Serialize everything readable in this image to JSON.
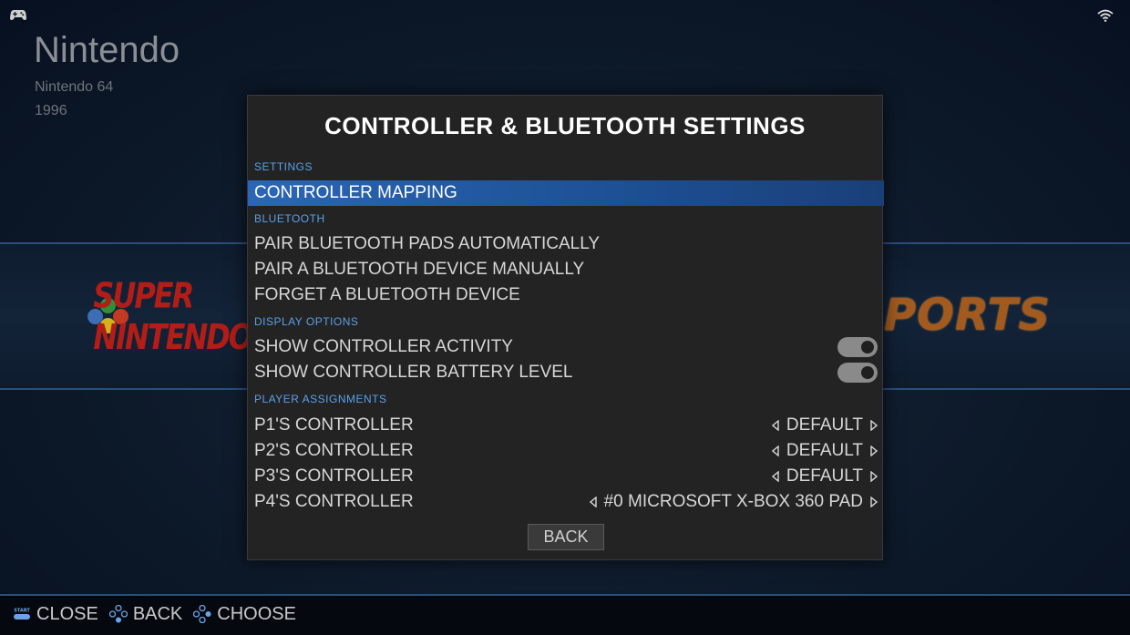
{
  "background": {
    "system_name": "Nintendo",
    "system_subtitle": "Nintendo 64",
    "system_year": "1996",
    "left_logo_text": "SUPER NINTENDO",
    "right_logo_text": "PORTS"
  },
  "status": {
    "left_icon": "gamepad-icon",
    "right_icon": "wifi-icon"
  },
  "dialog": {
    "title": "CONTROLLER & BLUETOOTH SETTINGS",
    "sections": {
      "settings": "SETTINGS",
      "bluetooth": "BLUETOOTH",
      "display": "DISPLAY OPTIONS",
      "players": "PLAYER ASSIGNMENTS"
    },
    "items": {
      "controller_mapping": "CONTROLLER MAPPING",
      "pair_auto": "PAIR BLUETOOTH PADS AUTOMATICALLY",
      "pair_manual": "PAIR A BLUETOOTH DEVICE MANUALLY",
      "forget": "FORGET A BLUETOOTH DEVICE",
      "show_activity": "SHOW CONTROLLER ACTIVITY",
      "show_battery": "SHOW CONTROLLER BATTERY LEVEL"
    },
    "toggles": {
      "show_activity": true,
      "show_battery": true
    },
    "players": [
      {
        "label": "P1'S CONTROLLER",
        "value": "DEFAULT"
      },
      {
        "label": "P2'S CONTROLLER",
        "value": "DEFAULT"
      },
      {
        "label": "P3'S CONTROLLER",
        "value": "DEFAULT"
      },
      {
        "label": "P4'S CONTROLLER",
        "value": "#0 MICROSOFT X-BOX 360 PAD"
      }
    ],
    "back_label": "BACK"
  },
  "help": {
    "close": "CLOSE",
    "back": "BACK",
    "choose": "CHOOSE",
    "start_badge": "START"
  },
  "colors": {
    "accent_blue": "#5aa0ea",
    "selection": "#2b66b6",
    "dialog_bg": "#232323"
  }
}
